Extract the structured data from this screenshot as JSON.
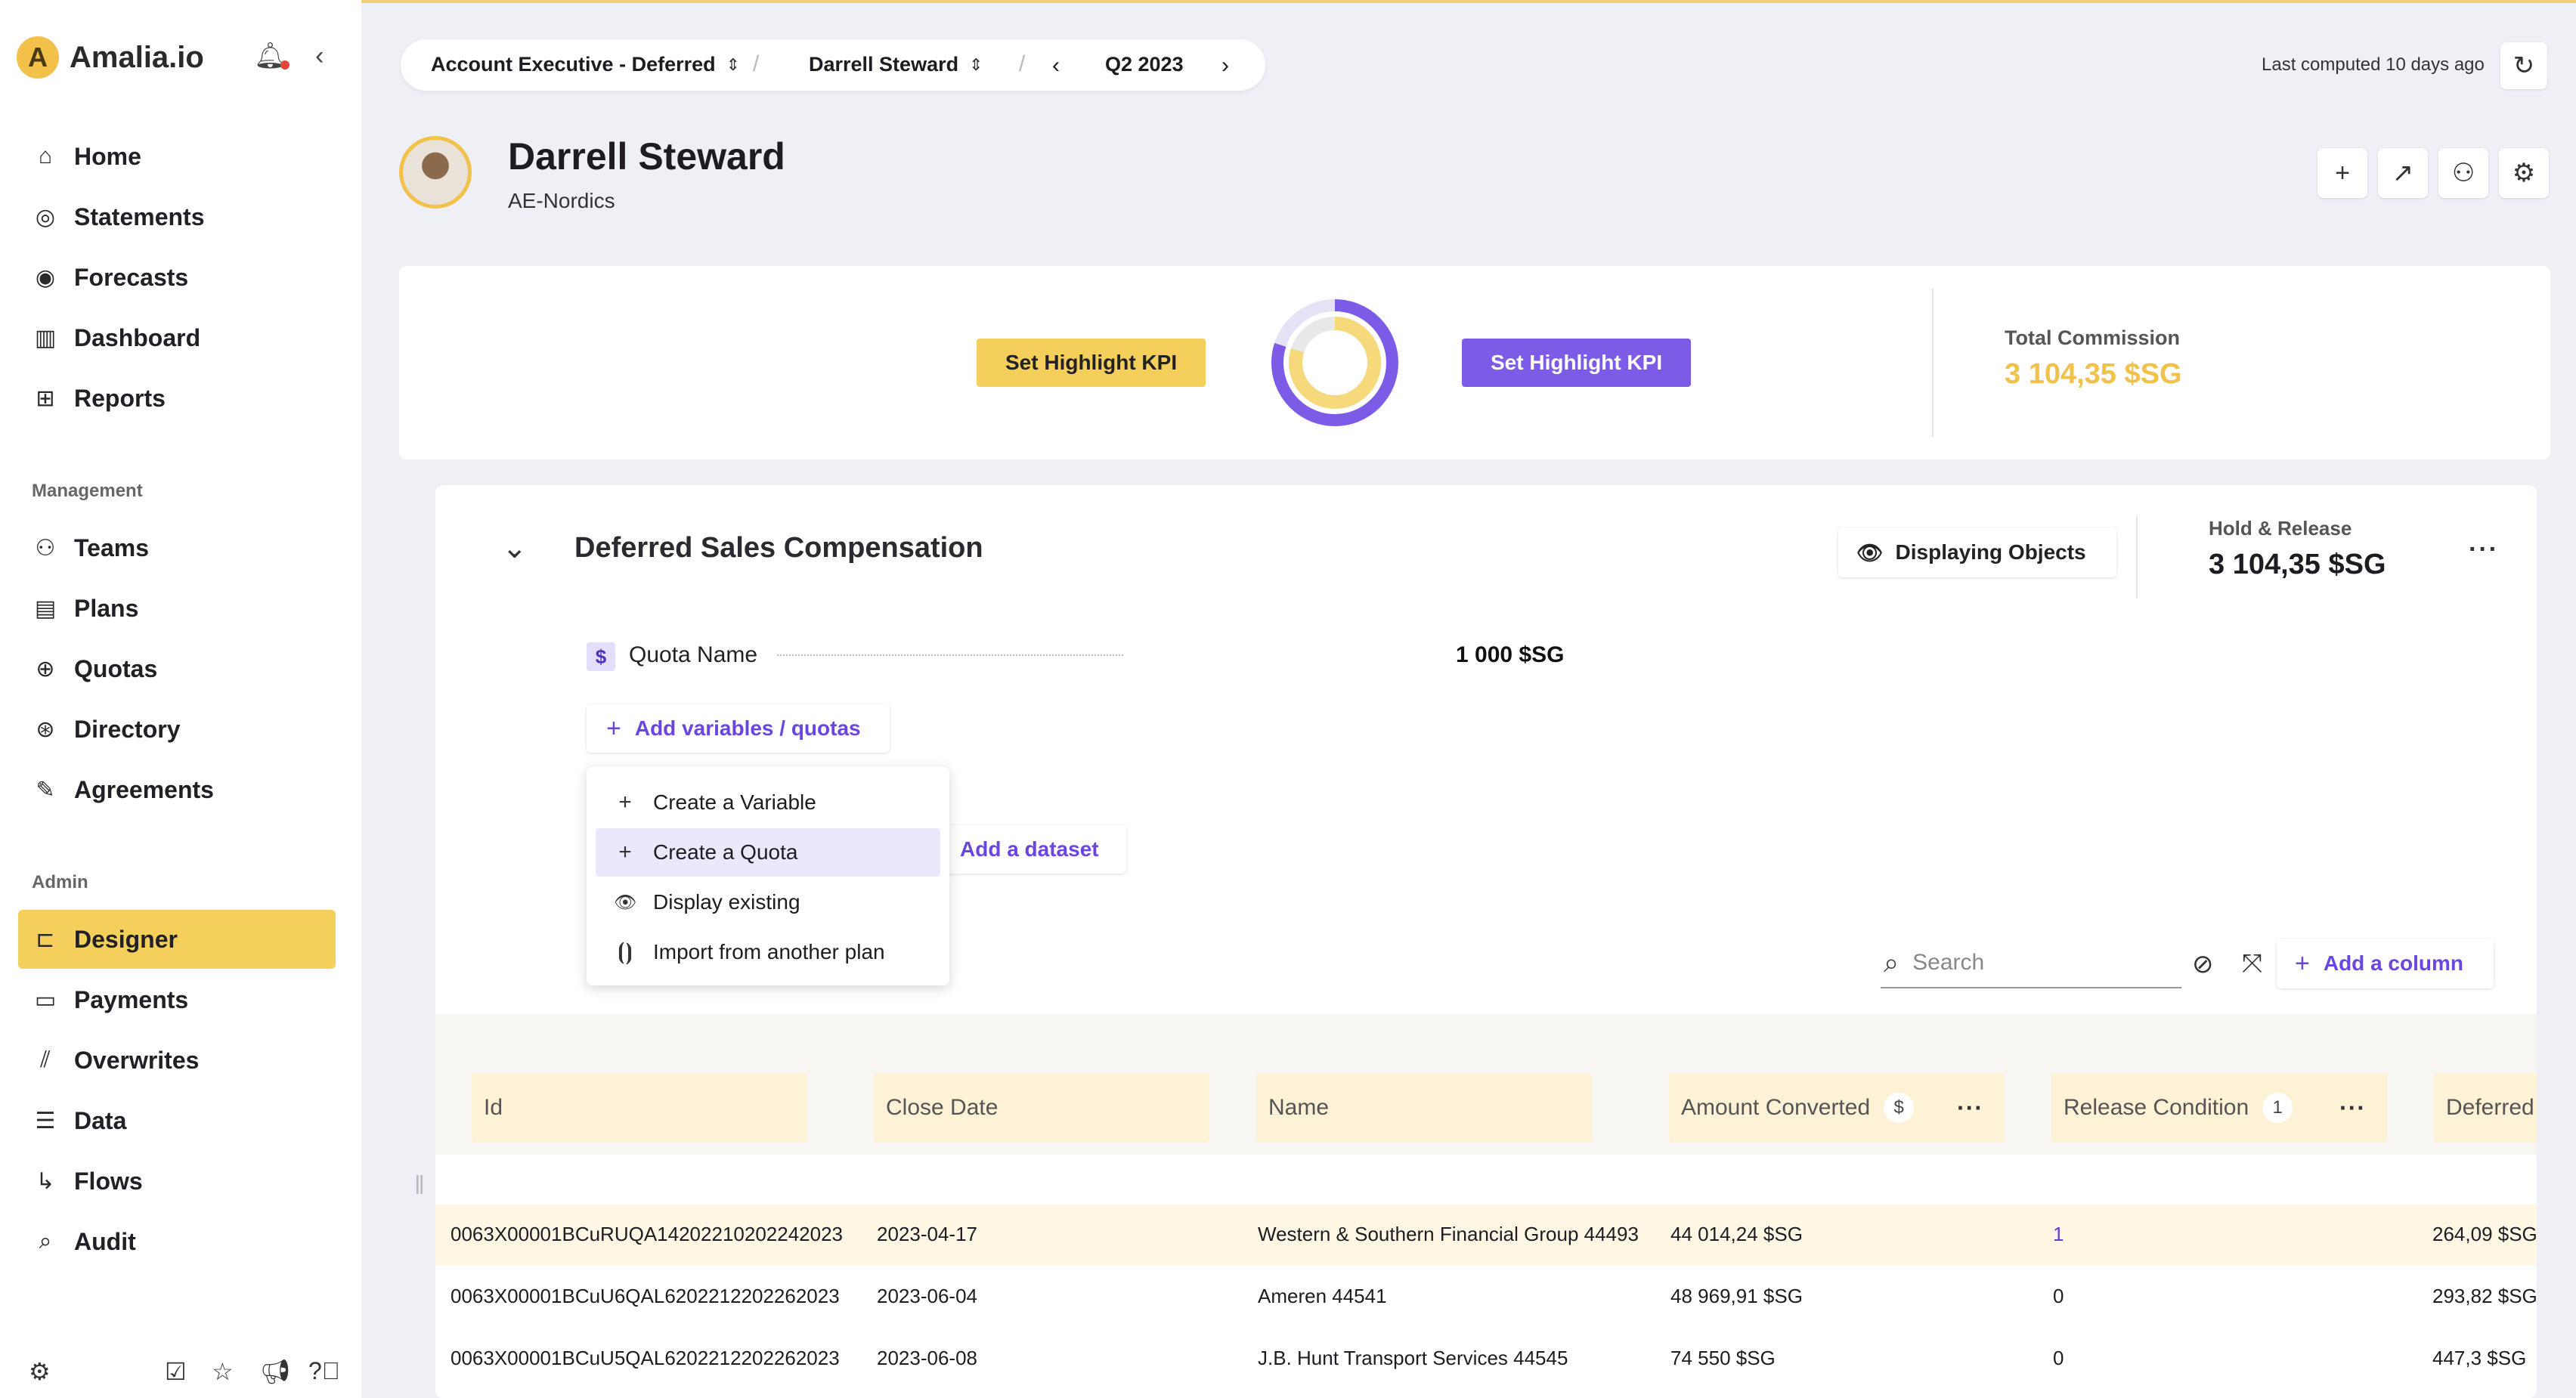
{
  "app": {
    "logo_letter": "A",
    "logo_text": "Amalia.io"
  },
  "sidebar": {
    "nav_main": [
      {
        "label": "Home",
        "icon": "home-icon"
      },
      {
        "label": "Statements",
        "icon": "statements-icon"
      },
      {
        "label": "Forecasts",
        "icon": "forecasts-icon"
      },
      {
        "label": "Dashboard",
        "icon": "dashboard-icon"
      },
      {
        "label": "Reports",
        "icon": "reports-icon"
      }
    ],
    "management_label": "Management",
    "nav_management": [
      {
        "label": "Teams",
        "icon": "teams-icon"
      },
      {
        "label": "Plans",
        "icon": "plans-icon"
      },
      {
        "label": "Quotas",
        "icon": "quotas-icon"
      },
      {
        "label": "Directory",
        "icon": "directory-icon"
      },
      {
        "label": "Agreements",
        "icon": "agreements-icon"
      }
    ],
    "admin_label": "Admin",
    "nav_admin": [
      {
        "label": "Designer",
        "icon": "designer-icon",
        "active": true
      },
      {
        "label": "Payments",
        "icon": "payments-icon"
      },
      {
        "label": "Overwrites",
        "icon": "overwrites-icon"
      },
      {
        "label": "Data",
        "icon": "data-icon"
      },
      {
        "label": "Flows",
        "icon": "flows-icon"
      },
      {
        "label": "Audit",
        "icon": "audit-icon"
      }
    ]
  },
  "topbar": {
    "plan": "Account Executive - Deferred",
    "user": "Darrell Steward",
    "period": "Q2 2023",
    "last_computed": "Last computed 10 days ago"
  },
  "profile": {
    "name": "Darrell Steward",
    "team": "AE-Nordics"
  },
  "kpi": {
    "highlight_left": "Set Highlight KPI",
    "highlight_right": "Set Highlight KPI",
    "total_commission_label": "Total Commission",
    "total_commission_value": "3 104,35 $SG",
    "donut_fraction": 0.8
  },
  "rule": {
    "title": "Deferred Sales Compensation",
    "displaying_objects": "Displaying Objects",
    "hold_release_label": "Hold & Release",
    "hold_release_value": "3 104,35 $SG",
    "quota_badge": "$",
    "quota_name": "Quota Name",
    "quota_value": "1 000 $SG",
    "add_variables": "Add variables / quotas",
    "add_dataset": "Add a dataset",
    "dropdown": [
      {
        "label": "Create a Variable",
        "icon": "plus-icon"
      },
      {
        "label": "Create a Quota",
        "icon": "plus-icon"
      },
      {
        "label": "Display existing",
        "icon": "eye-icon"
      },
      {
        "label": "Import from another plan",
        "icon": "import-icon"
      }
    ],
    "search_placeholder": "Search",
    "add_column": "Add a column"
  },
  "table": {
    "columns": [
      {
        "label": "Id"
      },
      {
        "label": "Close Date"
      },
      {
        "label": "Name"
      },
      {
        "label": "Amount Converted",
        "badge": "$"
      },
      {
        "label": "Release Condition",
        "badge": "1"
      },
      {
        "label": "Deferred"
      }
    ],
    "rows": [
      [
        "0063X00001BCuRUQA14202210202242023",
        "2023-04-17",
        "Western & Southern Financial Group 44493",
        "44 014,24 $SG",
        "1",
        "264,09 $SG"
      ],
      [
        "0063X00001BCuU6QAL6202212202262023",
        "2023-06-04",
        "Ameren 44541",
        "48 969,91 $SG",
        "0",
        "293,82 $SG"
      ],
      [
        "0063X00001BCuU5QAL6202212202262023",
        "2023-06-08",
        "J.B. Hunt Transport Services 44545",
        "74 550 $SG",
        "0",
        "447,3 $SG"
      ]
    ]
  },
  "colors": {
    "accent": "#7c5ce6",
    "brand_yellow": "#f5cf5b",
    "commission": "#f2c14a"
  }
}
